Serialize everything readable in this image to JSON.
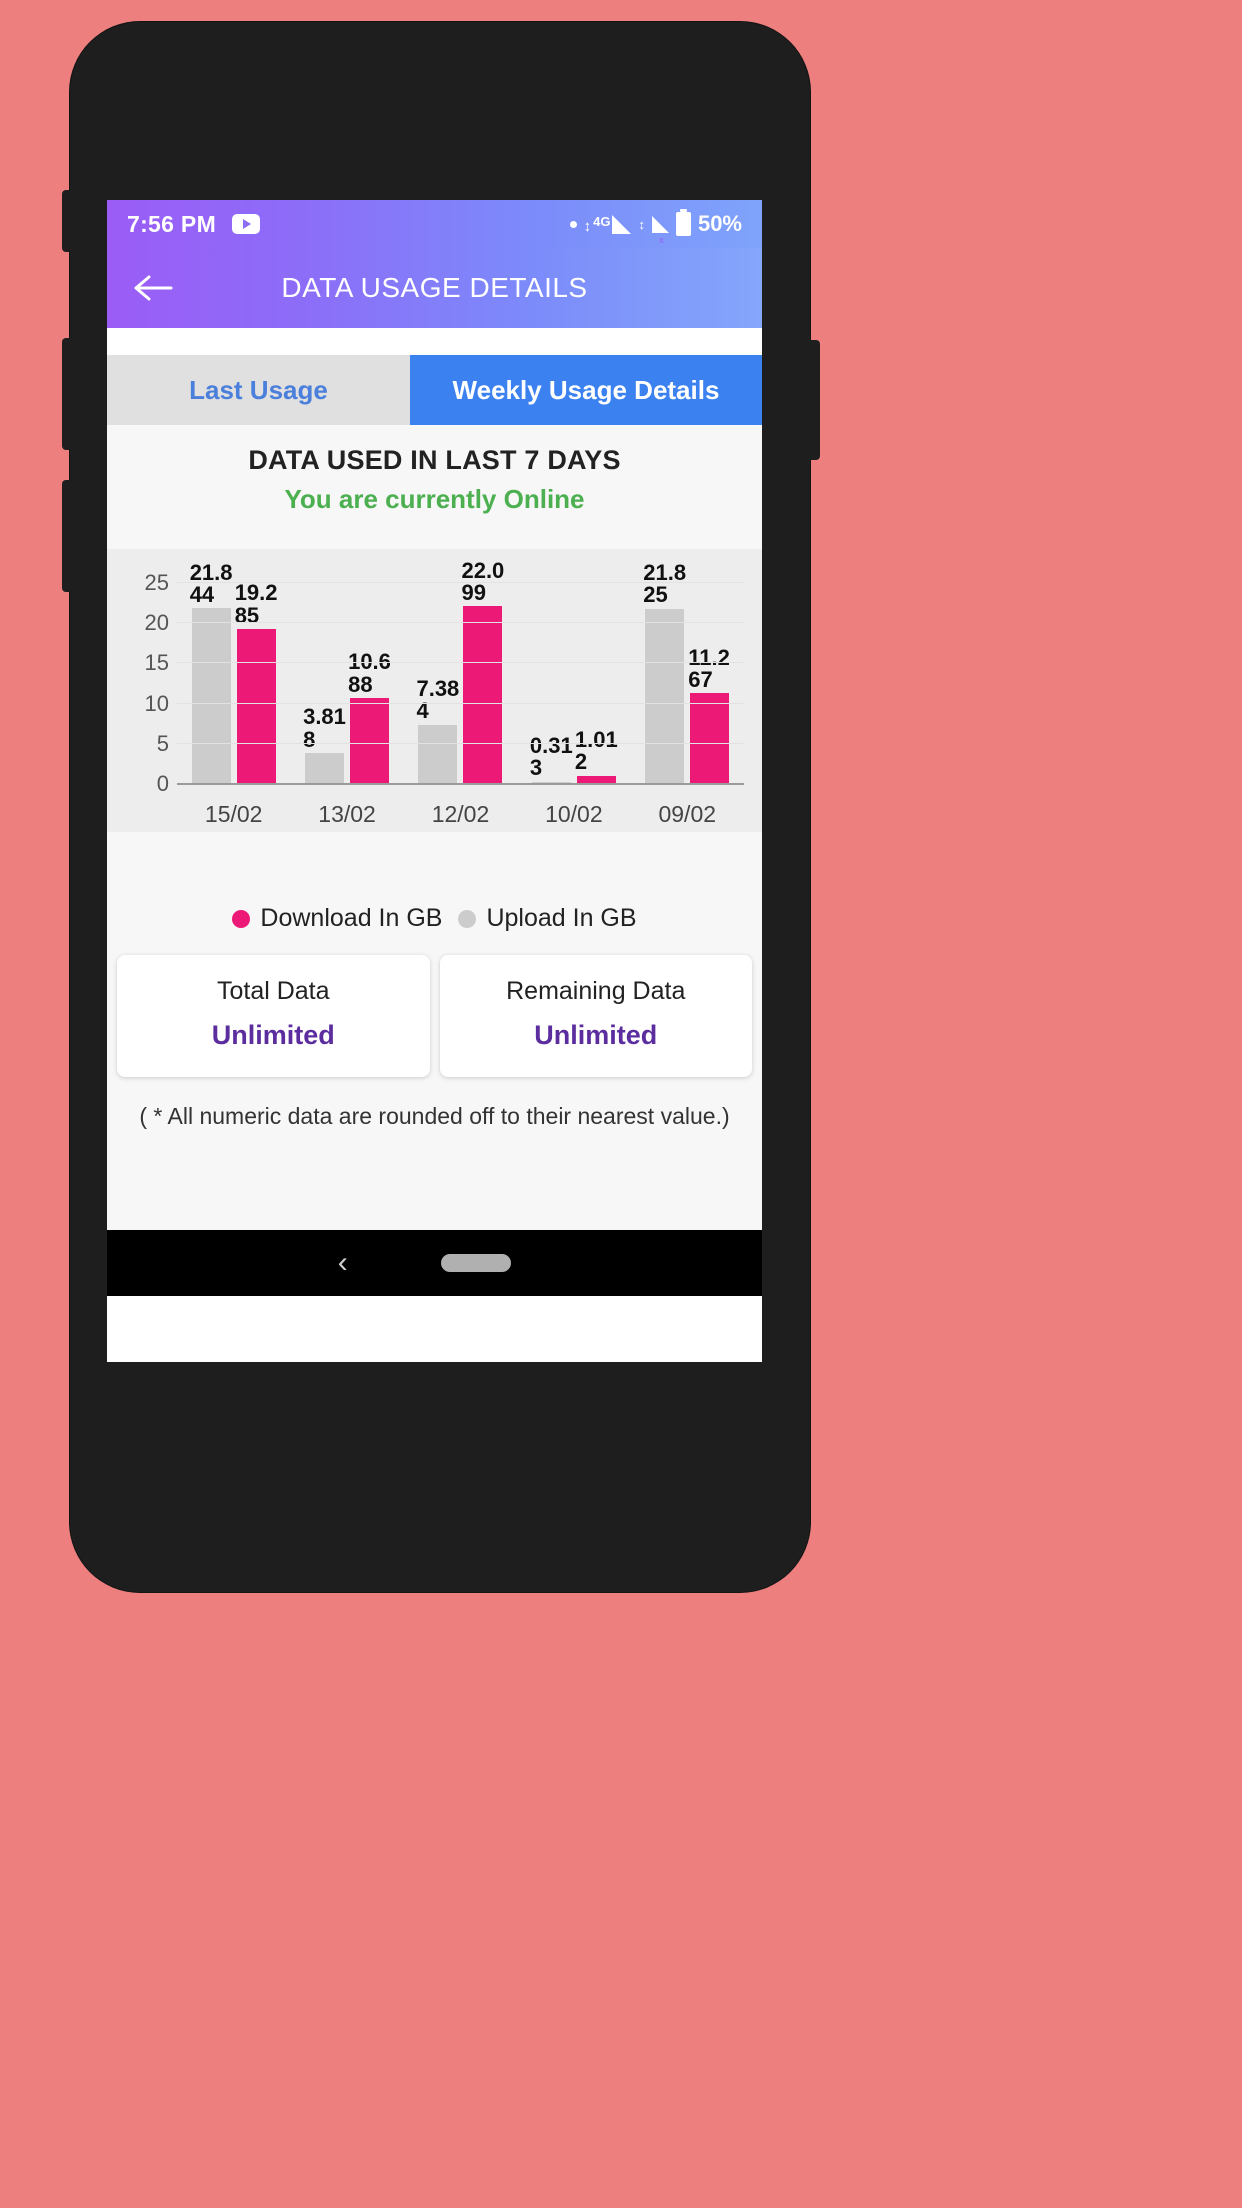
{
  "status_bar": {
    "time": "7:56 PM",
    "youtube_icon": "youtube-icon",
    "network_label": "4G",
    "battery_percent": "50%"
  },
  "app_bar": {
    "back_icon": "back-arrow-icon",
    "title": "DATA USAGE DETAILS"
  },
  "tabs": [
    {
      "label": "Last Usage",
      "active": false
    },
    {
      "label": "Weekly Usage Details",
      "active": true
    }
  ],
  "headline": {
    "title": "DATA USED IN LAST 7 DAYS",
    "status": "You are currently Online",
    "status_color": "#4CAF50"
  },
  "chart_data": {
    "type": "bar",
    "title": "DATA USED IN LAST 7 DAYS",
    "xlabel": "",
    "ylabel": "",
    "categories": [
      "15/02",
      "13/02",
      "12/02",
      "10/02",
      "09/02"
    ],
    "series": [
      {
        "name": "Upload In GB",
        "color": "#CCCCCC",
        "values": [
          21.844,
          3.818,
          7.384,
          0.313,
          21.825
        ]
      },
      {
        "name": "Download In GB",
        "color": "#EC1A76",
        "values": [
          19.285,
          10.688,
          22.099,
          1.012,
          11.267
        ]
      }
    ],
    "bar_labels": {
      "upload": [
        "21.844",
        "3.818",
        "7.384",
        "0.313",
        "21.825"
      ],
      "download": [
        "19.285",
        "10.688",
        "22.099",
        "1.012",
        "11.267"
      ]
    },
    "yticks": [
      0,
      5,
      10,
      15,
      20,
      25
    ],
    "ytick_labels": [
      "0",
      "5",
      "10",
      "15",
      "20",
      "25"
    ],
    "ylim": [
      0,
      27
    ],
    "grid": true,
    "legend_position": "bottom"
  },
  "legend": [
    {
      "label": "Download In GB",
      "color": "#EC1A76"
    },
    {
      "label": "Upload In GB",
      "color": "#CCCCCC"
    }
  ],
  "cards": [
    {
      "title": "Total Data",
      "value": "Unlimited"
    },
    {
      "title": "Remaining Data",
      "value": "Unlimited"
    }
  ],
  "footnote": "( * All numeric data are rounded off to their nearest value.)",
  "nav_bar": {
    "back_icon": "nav-back-icon",
    "home_icon": "nav-home-pill-icon"
  },
  "theme": {
    "background": "#EE7F7F",
    "frame": "#1E1E1E",
    "accent_purple": "#9B5CF6",
    "accent_blue": "#3B82F0",
    "pink": "#EC1A76",
    "gray_bar": "#CCCCCC",
    "card_value_color": "#5B2D9E"
  }
}
